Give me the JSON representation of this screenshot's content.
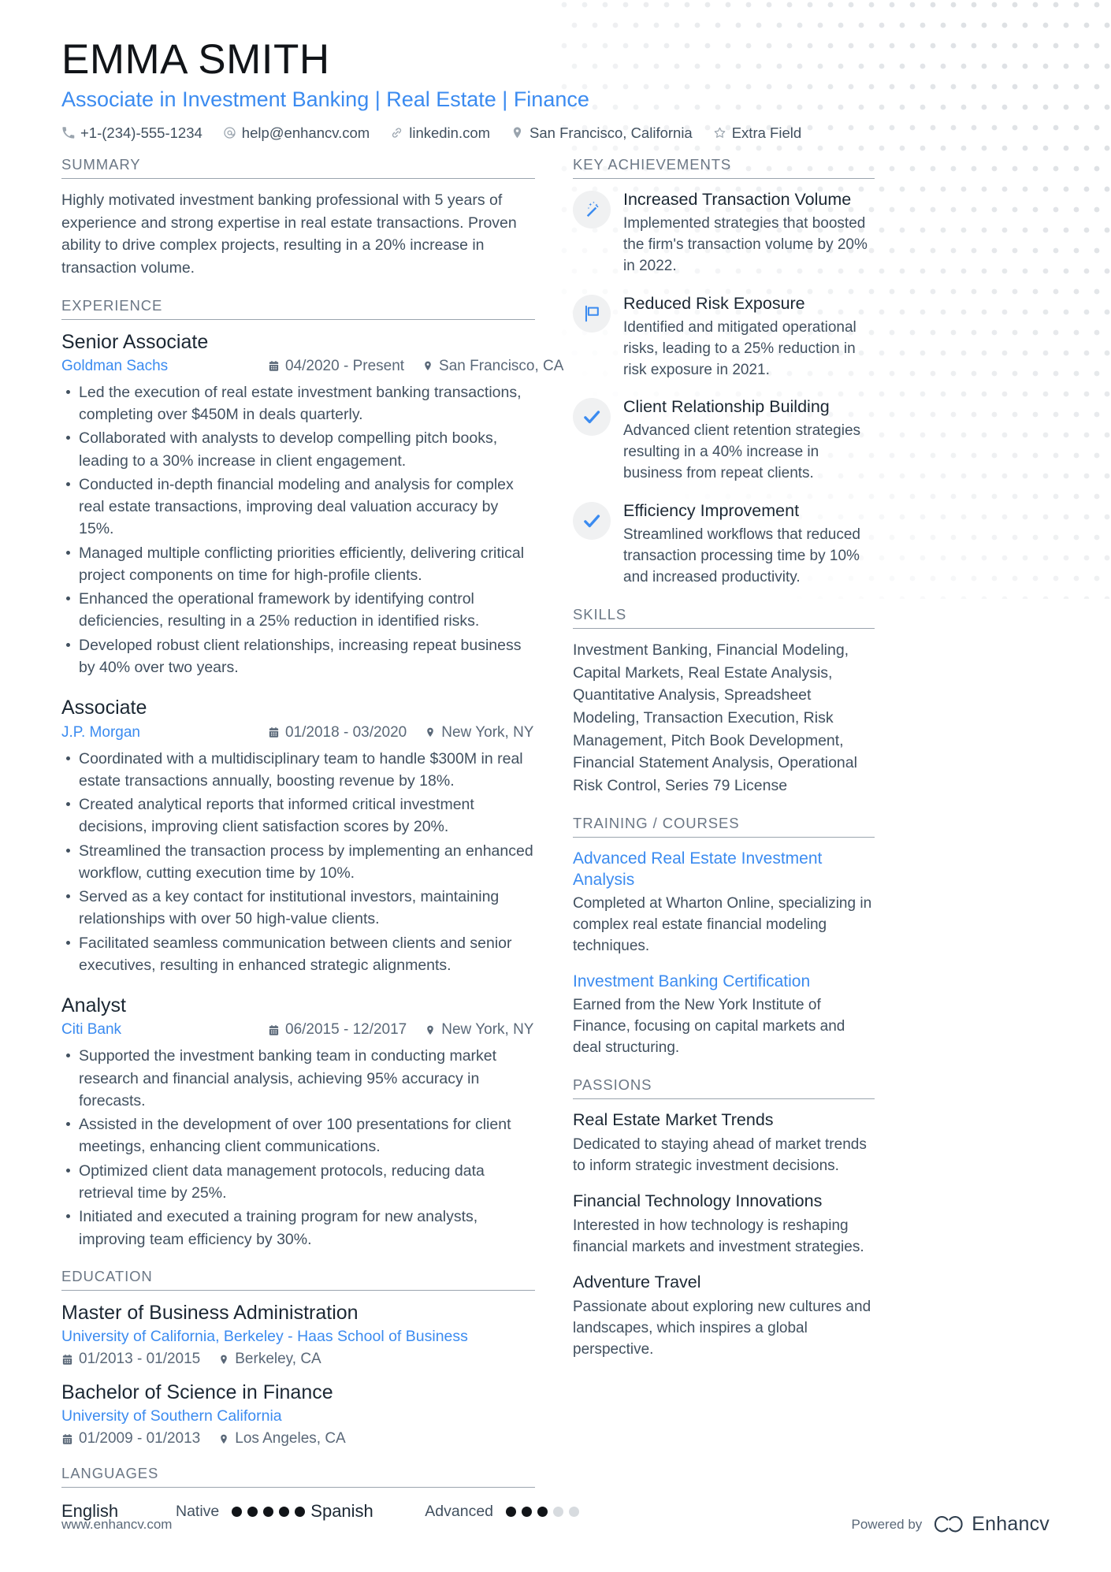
{
  "header": {
    "full_name": "EMMA SMITH",
    "job_title": "Associate in Investment Banking | Real Estate | Finance",
    "contacts": [
      {
        "icon": "phone-icon",
        "text": "+1-(234)-555-1234"
      },
      {
        "icon": "email-icon",
        "text": "help@enhancv.com"
      },
      {
        "icon": "link-icon",
        "text": "linkedin.com"
      },
      {
        "icon": "location-icon",
        "text": "San Francisco, California"
      },
      {
        "icon": "star-icon",
        "text": "Extra Field"
      }
    ]
  },
  "left": {
    "summary": {
      "title": "SUMMARY",
      "text": "Highly motivated investment banking professional with 5 years of experience and strong expertise in real estate transactions. Proven ability to drive complex projects, resulting in a 20% increase in transaction volume."
    },
    "experience": {
      "title": "EXPERIENCE",
      "entries": [
        {
          "role": "Senior Associate",
          "organization": "Goldman Sachs",
          "dates": "04/2020 - Present",
          "location": "San Francisco, CA",
          "bullets": [
            "Led the execution of real estate investment banking transactions, completing over $450M in deals quarterly.",
            "Collaborated with analysts to develop compelling pitch books, leading to a 30% increase in client engagement.",
            "Conducted in-depth financial modeling and analysis for complex real estate transactions, improving deal valuation accuracy by 15%.",
            "Managed multiple conflicting priorities efficiently, delivering critical project components on time for high-profile clients.",
            "Enhanced the operational framework by identifying control deficiencies, resulting in a 25% reduction in identified risks.",
            "Developed robust client relationships, increasing repeat business by 40% over two years."
          ]
        },
        {
          "role": "Associate",
          "organization": "J.P. Morgan",
          "dates": "01/2018 - 03/2020",
          "location": "New York, NY",
          "bullets": [
            "Coordinated with a multidisciplinary team to handle $300M in real estate transactions annually, boosting revenue by 18%.",
            "Created analytical reports that informed critical investment decisions, improving client satisfaction scores by 20%.",
            "Streamlined the transaction process by implementing an enhanced workflow, cutting execution time by 10%.",
            "Served as a key contact for institutional investors, maintaining relationships with over 50 high-value clients.",
            "Facilitated seamless communication between clients and senior executives, resulting in enhanced strategic alignments."
          ]
        },
        {
          "role": "Analyst",
          "organization": "Citi Bank",
          "dates": "06/2015 - 12/2017",
          "location": "New York, NY",
          "bullets": [
            "Supported the investment banking team in conducting market research and financial analysis, achieving 95% accuracy in forecasts.",
            "Assisted in the development of over 100 presentations for client meetings, enhancing client communications.",
            "Optimized client data management protocols, reducing data retrieval time by 25%.",
            "Initiated and executed a training program for new analysts, improving team efficiency by 30%."
          ]
        }
      ]
    },
    "education": {
      "title": "EDUCATION",
      "entries": [
        {
          "degree": "Master of Business Administration",
          "school": "University of California, Berkeley - Haas School of Business",
          "dates": "01/2013 - 01/2015",
          "location": "Berkeley, CA"
        },
        {
          "degree": "Bachelor of Science in Finance",
          "school": "University of Southern California",
          "dates": "01/2009 - 01/2013",
          "location": "Los Angeles, CA"
        }
      ]
    },
    "languages": {
      "title": "LANGUAGES",
      "items": [
        {
          "name": "English",
          "level": "Native",
          "filled": 5,
          "total": 5
        },
        {
          "name": "Spanish",
          "level": "Advanced",
          "filled": 3,
          "total": 5
        }
      ]
    }
  },
  "right": {
    "achievements": {
      "title": "KEY ACHIEVEMENTS",
      "items": [
        {
          "icon": "magic-wand-icon",
          "title": "Increased Transaction Volume",
          "desc": "Implemented strategies that boosted the firm's transaction volume by 20% in 2022."
        },
        {
          "icon": "flag-icon",
          "title": "Reduced Risk Exposure",
          "desc": "Identified and mitigated operational risks, leading to a 25% reduction in risk exposure in 2021."
        },
        {
          "icon": "check-icon",
          "title": "Client Relationship Building",
          "desc": "Advanced client retention strategies resulting in a 40% increase in business from repeat clients."
        },
        {
          "icon": "check-icon",
          "title": "Efficiency Improvement",
          "desc": "Streamlined workflows that reduced transaction processing time by 10% and increased productivity."
        }
      ]
    },
    "skills": {
      "title": "SKILLS",
      "text": "Investment Banking, Financial Modeling, Capital Markets, Real Estate Analysis, Quantitative Analysis, Spreadsheet Modeling, Transaction Execution, Risk Management, Pitch Book Development, Financial Statement Analysis, Operational Risk Control, Series 79 License"
    },
    "training": {
      "title": "TRAINING / COURSES",
      "items": [
        {
          "title": "Advanced Real Estate Investment Analysis",
          "desc": "Completed at Wharton Online, specializing in complex real estate financial modeling techniques."
        },
        {
          "title": "Investment Banking Certification",
          "desc": "Earned from the New York Institute of Finance, focusing on capital markets and deal structuring."
        }
      ]
    },
    "passions": {
      "title": "PASSIONS",
      "items": [
        {
          "title": "Real Estate Market Trends",
          "desc": "Dedicated to staying ahead of market trends to inform strategic investment decisions."
        },
        {
          "title": "Financial Technology Innovations",
          "desc": "Interested in how technology is reshaping financial markets and investment strategies."
        },
        {
          "title": "Adventure Travel",
          "desc": "Passionate about exploring new cultures and landscapes, which inspires a global perspective."
        }
      ]
    }
  },
  "footer": {
    "website": "www.enhancv.com",
    "powered_by": "Powered by",
    "brand": "Enhancv"
  },
  "colors": {
    "accent_blue": "#3b8bf0",
    "heading_gray": "#6b7785",
    "body_text": "#41505f",
    "dark_text": "#1b2733",
    "icon_bubble": "#f0f1f2"
  }
}
